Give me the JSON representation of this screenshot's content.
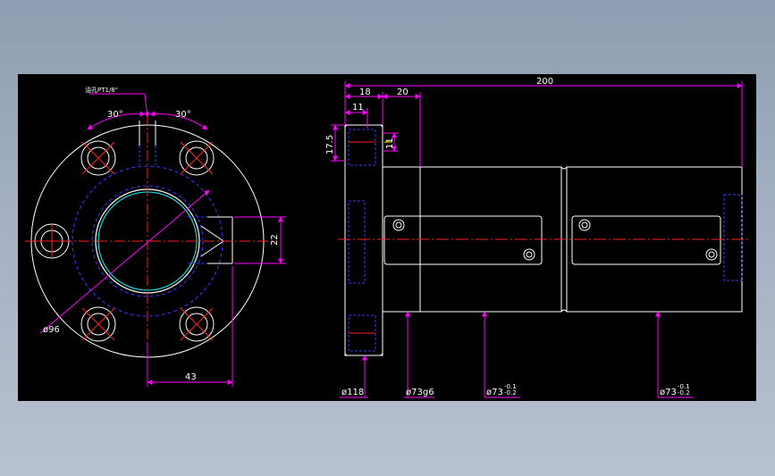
{
  "drawing": {
    "front_view": {
      "thread_note": "油孔PT1/8\"",
      "angle_left": "30°",
      "angle_right": "30°",
      "dia_bolt_circle": "ø96",
      "dim_43": "43",
      "dim_22": "22"
    },
    "side_view": {
      "dim_200": "200",
      "dim_18": "18",
      "dim_20": "20",
      "dim_11_top": "11",
      "dim_17_5": "17.5",
      "dim_11_vert": "11",
      "dia_118": "ø118",
      "dia_73g6": "ø73g6",
      "dia_73_mid": "ø73",
      "dia_73_mid_tol_upper": "-0.1",
      "dia_73_mid_tol_lower": "-0.2",
      "dia_73_right": "ø73",
      "dia_73_right_tol_upper": "-0.1",
      "dia_73_right_tol_lower": "-0.2"
    }
  },
  "colors": {
    "background": "#000000",
    "outline": "#ffffff",
    "dimension": "#ff00ff",
    "centerline": "#ff2020",
    "hidden": "#3a3aff",
    "cyan": "#00ffff",
    "yellow": "#ffff00"
  }
}
